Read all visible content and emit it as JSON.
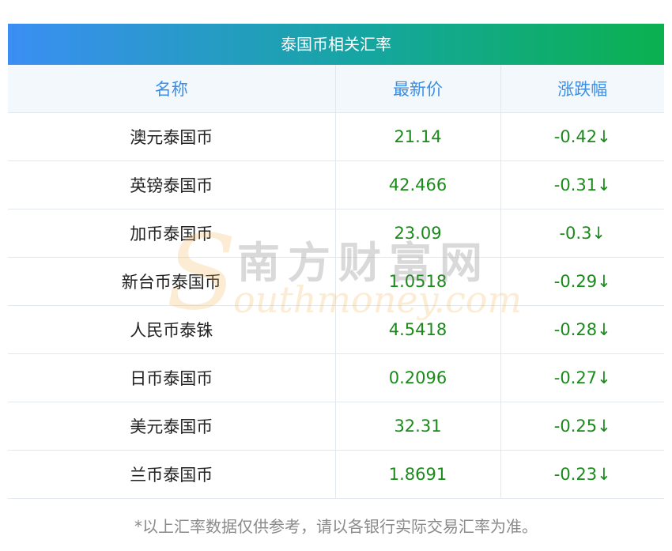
{
  "table": {
    "title": "泰国币相关汇率",
    "headers": [
      "名称",
      "最新价",
      "涨跌幅"
    ],
    "rows": [
      {
        "name": "澳元泰国币",
        "price": "21.14",
        "change": "-0.42↓"
      },
      {
        "name": "英镑泰国币",
        "price": "42.466",
        "change": "-0.31↓"
      },
      {
        "name": "加币泰国币",
        "price": "23.09",
        "change": "-0.3↓"
      },
      {
        "name": "新台币泰国币",
        "price": "1.0518",
        "change": "-0.29↓"
      },
      {
        "name": "人民币泰铢",
        "price": "4.5418",
        "change": "-0.28↓"
      },
      {
        "name": "日币泰国币",
        "price": "0.2096",
        "change": "-0.27↓"
      },
      {
        "name": "美元泰国币",
        "price": "32.31",
        "change": "-0.25↓"
      },
      {
        "name": "兰币泰国币",
        "price": "1.8691",
        "change": "-0.23↓"
      }
    ]
  },
  "watermark": {
    "chinese": "南方财富网",
    "english": "outhmoney.com",
    "letter": "S"
  },
  "footnote": "*以上汇率数据仅供参考，请以各银行实际交易汇率为准。",
  "colors": {
    "header_text": "#3a8ee6",
    "positive_green": "#1a8a1a",
    "title_gradient_start": "#3b8ef3",
    "title_gradient_end": "#0bb14f"
  }
}
